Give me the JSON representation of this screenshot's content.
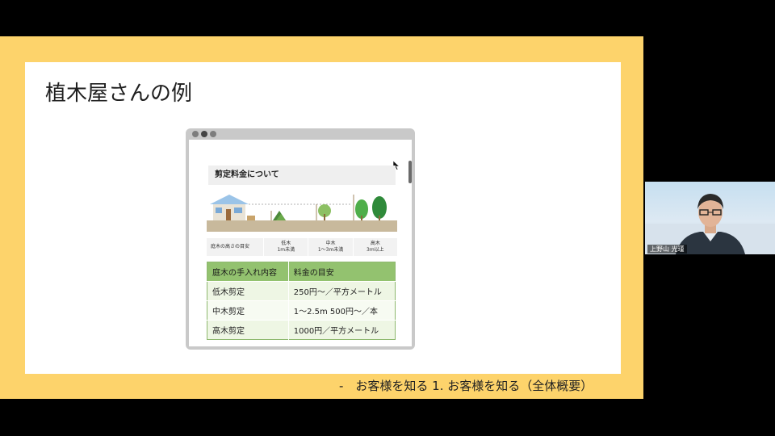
{
  "slide": {
    "title": "植木屋さんの例",
    "footer": "-　お客様を知る 1. お客様を知る（全体概要）"
  },
  "browser": {
    "section_heading": "剪定料金について",
    "legend": {
      "label": "庭木の高さの目安",
      "low": [
        "低木",
        "1m未満"
      ],
      "mid": [
        "中木",
        "1～3m未満"
      ],
      "high": [
        "高木",
        "3m以上"
      ]
    },
    "table": {
      "headers": [
        "庭木の手入れ内容",
        "料金の目安"
      ],
      "rows": [
        [
          "低木剪定",
          "250円～／平方メートル"
        ],
        [
          "中木剪定",
          "1～2.5m 500円～／本"
        ],
        [
          "高木剪定",
          "1000円／平方メートル"
        ]
      ]
    }
  },
  "video": {
    "participant_name": "上野山 光瑾"
  },
  "colors": {
    "frame": "#fdd36b",
    "table_header": "#93c26f",
    "table_row": "#eef6e4"
  }
}
